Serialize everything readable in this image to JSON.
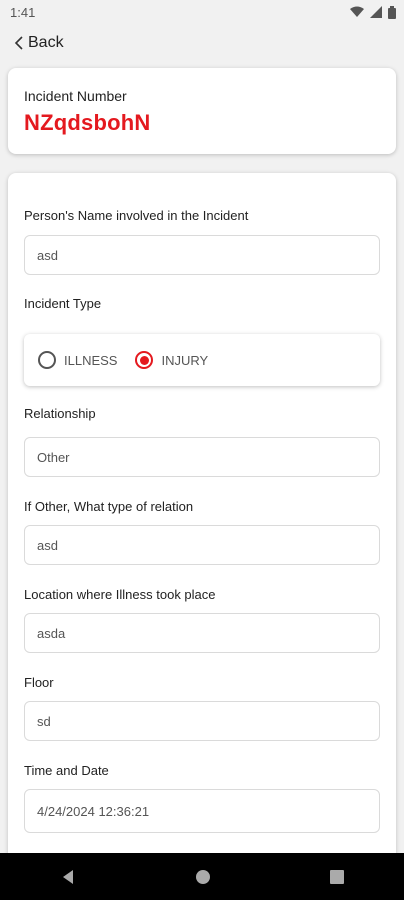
{
  "status": {
    "time": "1:41",
    "icons": [
      "wifi-icon",
      "signal-icon",
      "battery-icon"
    ]
  },
  "nav": {
    "back_label": "Back"
  },
  "incident": {
    "label": "Incident Number",
    "number": "NZqdsbohN",
    "accent": "#e4191f"
  },
  "form": {
    "person_name": {
      "label": "Person's Name involved in the Incident",
      "value": "asd"
    },
    "incident_type": {
      "label": "Incident Type",
      "options": [
        {
          "label": "ILLNESS",
          "selected": false
        },
        {
          "label": "INJURY",
          "selected": true
        }
      ]
    },
    "relationship": {
      "label": "Relationship",
      "value": "Other"
    },
    "other_relation": {
      "label": "If Other, What type of relation",
      "value": "asd"
    },
    "location": {
      "label": "Location where Illness took place",
      "value": "asda"
    },
    "floor": {
      "label": "Floor",
      "value": "sd"
    },
    "time_date": {
      "label": "Time and Date",
      "value": "4/24/2024 12:36:21"
    }
  },
  "system_nav": {
    "icons": [
      "back-triangle-icon",
      "home-circle-icon",
      "recents-square-icon"
    ]
  }
}
